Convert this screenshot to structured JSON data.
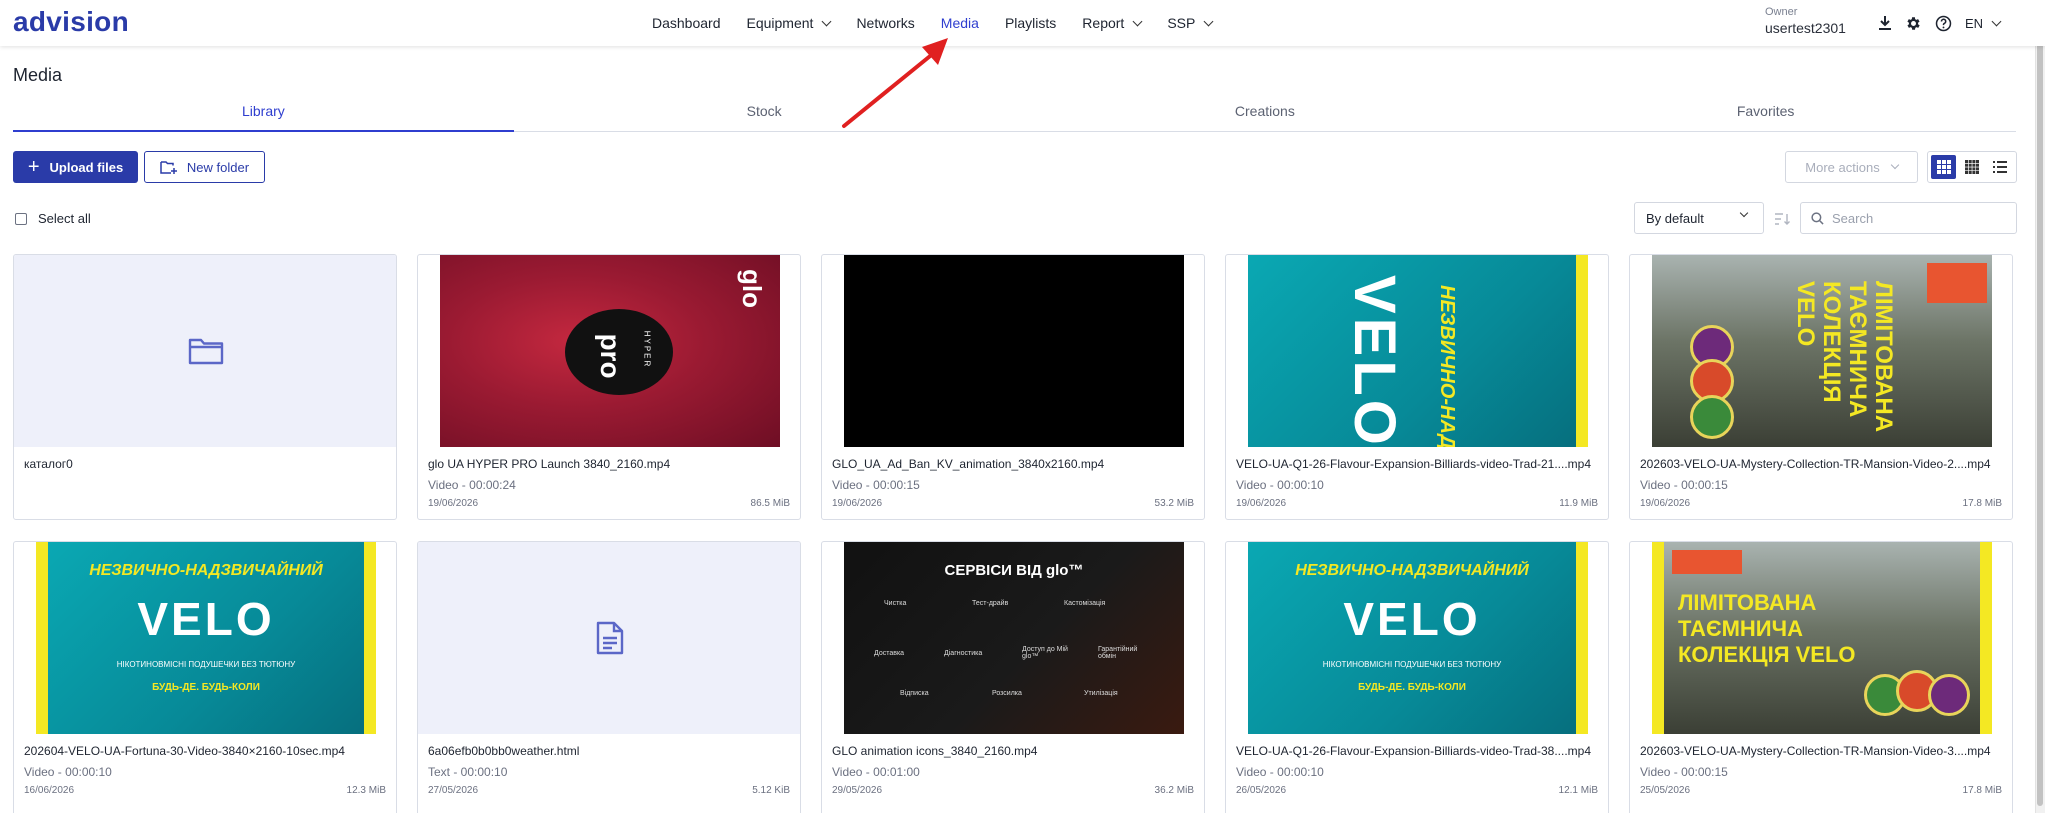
{
  "app": {
    "logo": "advision"
  },
  "nav": {
    "items": [
      {
        "label": "Dashboard",
        "active": false,
        "dropdown": false
      },
      {
        "label": "Equipment",
        "active": false,
        "dropdown": true
      },
      {
        "label": "Networks",
        "active": false,
        "dropdown": false
      },
      {
        "label": "Media",
        "active": true,
        "dropdown": false
      },
      {
        "label": "Playlists",
        "active": false,
        "dropdown": false
      },
      {
        "label": "Report",
        "active": false,
        "dropdown": true
      },
      {
        "label": "SSP",
        "active": false,
        "dropdown": true
      }
    ]
  },
  "account": {
    "owner_label": "Owner",
    "username": "usertest2301",
    "language": "EN"
  },
  "icons": {
    "download": "download-icon",
    "settings": "gear-icon",
    "help": "help-icon"
  },
  "colors": {
    "accent": "#2f3ecf",
    "primary_button": "#2a3ba8",
    "annotation_arrow": "#e02020"
  },
  "page": {
    "title": "Media"
  },
  "tabs": [
    {
      "label": "Library",
      "active": true
    },
    {
      "label": "Stock",
      "active": false
    },
    {
      "label": "Creations",
      "active": false
    },
    {
      "label": "Favorites",
      "active": false
    }
  ],
  "toolbar": {
    "upload_label": "Upload files",
    "new_folder_label": "New folder",
    "more_actions_label": "More actions",
    "view_modes": [
      "large-grid",
      "small-grid",
      "list"
    ],
    "active_view": "large-grid",
    "select_all_label": "Select all",
    "sort_label": "By default",
    "search_placeholder": "Search"
  },
  "cards": [
    {
      "name": "каталог0",
      "type": "folder"
    },
    {
      "name": "glo UA HYPER PRO Launch 3840_2160.mp4",
      "meta": "Video - 00:00:24",
      "date": "19/06/2026",
      "size": "86.5 MiB",
      "art": {
        "brand": "glo",
        "product": "HYPER",
        "model": "pro"
      }
    },
    {
      "name": "GLO_UA_Ad_Ban_KV_animation_3840x2160.mp4",
      "meta": "Video - 00:00:15",
      "date": "19/06/2026",
      "size": "53.2 MiB"
    },
    {
      "name": "VELO-UA-Q1-26-Flavour-Expansion-Billiards-video-Trad-21....mp4",
      "meta": "Video - 00:00:10",
      "date": "19/06/2026",
      "size": "11.9 MiB",
      "art": {
        "tagline": "НЕЗВИЧНО-НАДЗВИЧАЙНИЙ",
        "brand": "VELO"
      }
    },
    {
      "name": "202603-VELO-UA-Mystery-Collection-TR-Mansion-Video-2....mp4",
      "meta": "Video - 00:00:15",
      "date": "19/06/2026",
      "size": "17.8 MiB",
      "art": {
        "headline": "ЛІМІТОВАНА ТАЄМНИЧА КОЛЕКЦІЯ VELO"
      }
    },
    {
      "name": "202604-VELO-UA-Fortuna-30-Video-3840×2160-10sec.mp4",
      "meta": "Video - 00:00:10",
      "date": "16/06/2026",
      "size": "12.3 MiB",
      "art": {
        "tagline": "НЕЗВИЧНО-НАДЗВИЧАЙНИЙ",
        "brand": "VELO",
        "sub": "НІКОТИНОВМІСНІ ПОДУШЕЧКИ БЕЗ ТЮТЮНУ",
        "cta": "БУДЬ-ДЕ. БУДЬ-КОЛИ"
      }
    },
    {
      "name": "6a06efb0b0bb0weather.html",
      "meta": "Text - 00:00:10",
      "date": "27/05/2026",
      "size": "5.12 KiB",
      "type": "text"
    },
    {
      "name": "GLO animation icons_3840_2160.mp4",
      "meta": "Video - 00:01:00",
      "date": "29/05/2026",
      "size": "36.2 MiB",
      "art": {
        "headline": "СЕРВІСИ ВІД glo™",
        "services": [
          "Чистка",
          "Тест-драйв",
          "Кастомізація",
          "Доставка",
          "Діагностика",
          "Доступ до Мій glo™",
          "Гарантійний обмін",
          "Відписка",
          "Розсилка",
          "Утилізація"
        ]
      }
    },
    {
      "name": "VELO-UA-Q1-26-Flavour-Expansion-Billiards-video-Trad-38....mp4",
      "meta": "Video - 00:00:10",
      "date": "26/05/2026",
      "size": "12.1 MiB",
      "art": {
        "tagline": "НЕЗВИЧНО-НАДЗВИЧАЙНИЙ",
        "brand": "VELO",
        "sub": "НІКОТИНОВМІСНІ ПОДУШЕЧКИ БЕЗ ТЮТЮНУ",
        "cta": "БУДЬ-ДЕ. БУДЬ-КОЛИ"
      }
    },
    {
      "name": "202603-VELO-UA-Mystery-Collection-TR-Mansion-Video-3....mp4",
      "meta": "Video - 00:00:15",
      "date": "25/05/2026",
      "size": "17.8 MiB",
      "art": {
        "headline": "ЛІМІТОВАНА ТАЄМНИЧА КОЛЕКЦІЯ VELO"
      }
    }
  ]
}
